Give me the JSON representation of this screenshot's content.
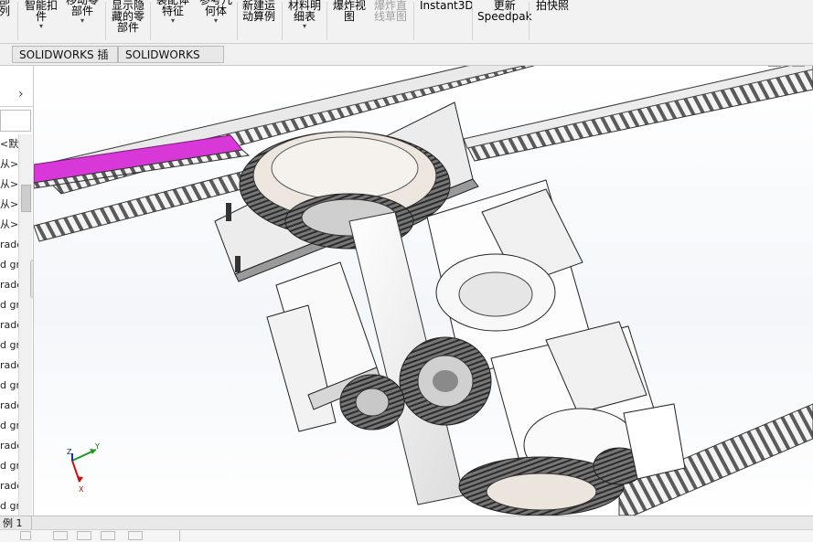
{
  "ribbon": {
    "items": [
      {
        "label": "部\n列",
        "disabled": false
      },
      {
        "label": "智能扣\n件",
        "disabled": false
      },
      {
        "label": "移动零\n部件",
        "disabled": false
      },
      {
        "label": "显示隐\n藏的零\n部件",
        "disabled": false
      },
      {
        "label": "装配体\n特征",
        "disabled": false
      },
      {
        "label": "参考几\n何体",
        "disabled": false
      },
      {
        "label": "新建运\n动算例",
        "disabled": false
      },
      {
        "label": "材料明\n细表",
        "disabled": false
      },
      {
        "label": "爆炸视\n图",
        "disabled": false
      },
      {
        "label": "爆炸直\n线草图",
        "disabled": true
      },
      {
        "label": "Instant3D",
        "disabled": false
      },
      {
        "label": "更新\nSpeedpak",
        "disabled": false
      },
      {
        "label": "拍快照",
        "disabled": false
      }
    ]
  },
  "tabs": [
    "SOLIDWORKS 插件",
    "SOLIDWORKS MBD"
  ],
  "left_panel": {
    "rows": [
      "<默",
      "从>_",
      "从>_",
      "从>_",
      "从>_",
      "rade",
      "d gr",
      "rade",
      "d gr",
      "rade",
      "d gr",
      "rade",
      "d gr",
      "rade",
      "d gr",
      "rade",
      "d gr",
      "rade",
      "d gr"
    ]
  },
  "status": {
    "tab_label": "例 1"
  },
  "triad": {
    "x": "X",
    "y": "Y",
    "z": "Z"
  },
  "colors": {
    "accent": "#d838d8",
    "gear": "#555555",
    "part": "#ffffff"
  }
}
